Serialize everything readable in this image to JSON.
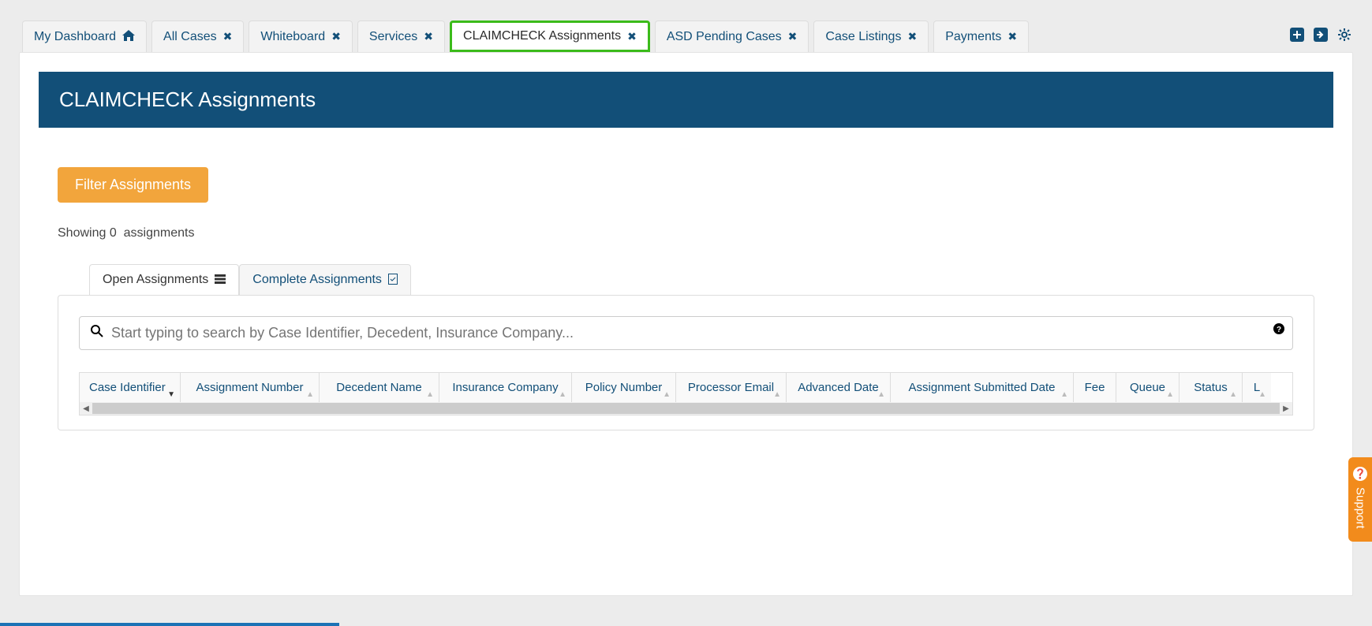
{
  "tabs": [
    {
      "label": "My Dashboard",
      "icon": "home"
    },
    {
      "label": "All Cases",
      "icon": "close"
    },
    {
      "label": "Whiteboard",
      "icon": "close"
    },
    {
      "label": "Services",
      "icon": "close"
    },
    {
      "label": "CLAIMCHECK Assignments",
      "icon": "close",
      "active": true
    },
    {
      "label": "ASD Pending Cases",
      "icon": "close"
    },
    {
      "label": "Case Listings",
      "icon": "close"
    },
    {
      "label": "Payments",
      "icon": "close"
    }
  ],
  "page": {
    "title": "CLAIMCHECK Assignments",
    "filter_button": "Filter Assignments",
    "showing_prefix": "Showing",
    "showing_count": "0",
    "showing_suffix": "assignments"
  },
  "subtabs": {
    "open": "Open Assignments",
    "complete": "Complete Assignments"
  },
  "search": {
    "placeholder": "Start typing to search by Case Identifier, Decedent, Insurance Company..."
  },
  "columns": {
    "ci": "Case Identifier",
    "an": "Assignment Number",
    "dn": "Decedent Name",
    "ic": "Insurance Company",
    "pn": "Policy Number",
    "pe": "Processor Email",
    "ad": "Advanced Date",
    "asd": "Assignment Submitted Date",
    "fee": "Fee",
    "q": "Queue",
    "st": "Status",
    "l": "L"
  },
  "support": {
    "label": "Support"
  }
}
